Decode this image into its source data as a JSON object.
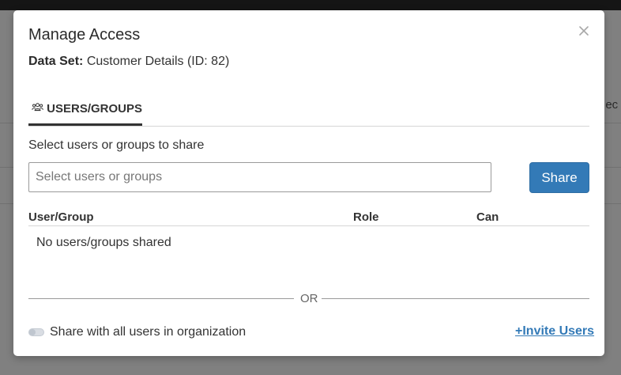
{
  "background": {
    "partial_text": "t ec"
  },
  "modal": {
    "title": "Manage Access",
    "close_icon": "close-icon",
    "dataset_label": "Data Set:",
    "dataset_value": "Customer Details (ID: 82)"
  },
  "tabs": [
    {
      "label": "USERS/GROUPS",
      "icon": "users-group-icon",
      "active": true
    }
  ],
  "share_form": {
    "label": "Select users or groups to share",
    "placeholder": "Select users or groups",
    "value": "",
    "share_button": "Share"
  },
  "table": {
    "columns": [
      "User/Group",
      "Role",
      "Can"
    ],
    "rows": [],
    "empty_text": "No users/groups shared"
  },
  "divider_text": "OR",
  "org_share": {
    "label": "Share with all users in organization",
    "enabled": false
  },
  "invite_link": "+Invite Users",
  "colors": {
    "primary": "#337ab7",
    "text": "#333333",
    "overlay": "#808080"
  }
}
